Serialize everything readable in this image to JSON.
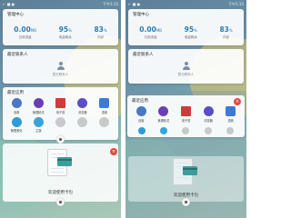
{
  "status": {
    "left_icons": "← ■ ●",
    "time": "下午5:15"
  },
  "management": {
    "title": "管理中心",
    "stats": [
      {
        "value": "0.00",
        "unit": "MB",
        "label": "已用流量"
      },
      {
        "value": "95",
        "unit": "%",
        "label": "电量剩余"
      },
      {
        "value": "83",
        "unit": "%",
        "label": "内存"
      }
    ]
  },
  "contacts": {
    "title": "最近联系人",
    "hint": "暂无联系人"
  },
  "recent_apps": {
    "title": "最近应用",
    "apps": [
      {
        "label": "设置",
        "color": "#4a78c4"
      },
      {
        "label": "管理精灵",
        "color": "#6a3fb5"
      },
      {
        "label": "电子首",
        "color": "#d23a3a"
      },
      {
        "label": "浏览器",
        "color": "#5a4fc8"
      },
      {
        "label": "语音",
        "color": "#3a7bd5"
      },
      {
        "label": "管理美化",
        "color": "#2f9ad6"
      },
      {
        "label": "主题",
        "color": "#38a4d8"
      },
      {
        "label": "",
        "color": "#c9c9c9"
      },
      {
        "label": "",
        "color": "#c9c9c9"
      },
      {
        "label": "",
        "color": "#c9c9c9"
      }
    ]
  },
  "welcome": {
    "text": "欢迎使用卡包"
  },
  "close_glyph": "×"
}
